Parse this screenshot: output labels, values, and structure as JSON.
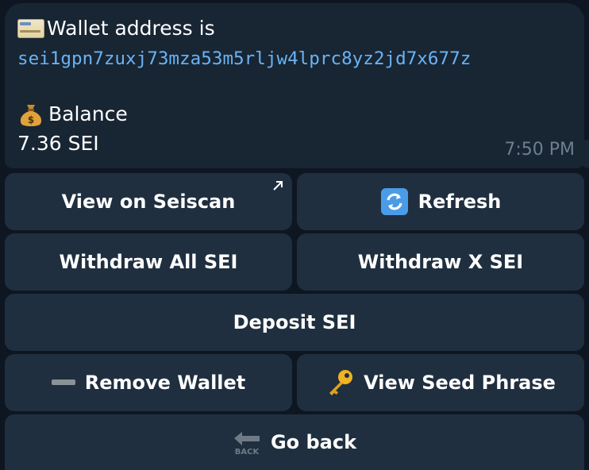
{
  "message": {
    "wallet_label": "Wallet address is",
    "wallet_address": "sei1gpn7zuxj73mza53m5rljw4lprc8yz2jd7x677z",
    "balance_label": "Balance",
    "balance_value": "7.36 SEI",
    "time": "7:50 PM",
    "icons": {
      "wallet": "credit-card-icon",
      "balance": "money-bag-icon"
    }
  },
  "keyboard": {
    "view_on_seiscan": "View on Seiscan",
    "refresh": "Refresh",
    "withdraw_all": "Withdraw All SEI",
    "withdraw_x": "Withdraw X SEI",
    "deposit": "Deposit SEI",
    "remove_wallet": "Remove Wallet",
    "view_seed_phrase": "View Seed Phrase",
    "go_back": "Go back",
    "back_icon_text": "BACK"
  },
  "colors": {
    "background": "#0e1621",
    "bubble": "#182533",
    "button": "#1f2f3f",
    "link": "#6ab3f3",
    "time": "#6d7f8f"
  }
}
